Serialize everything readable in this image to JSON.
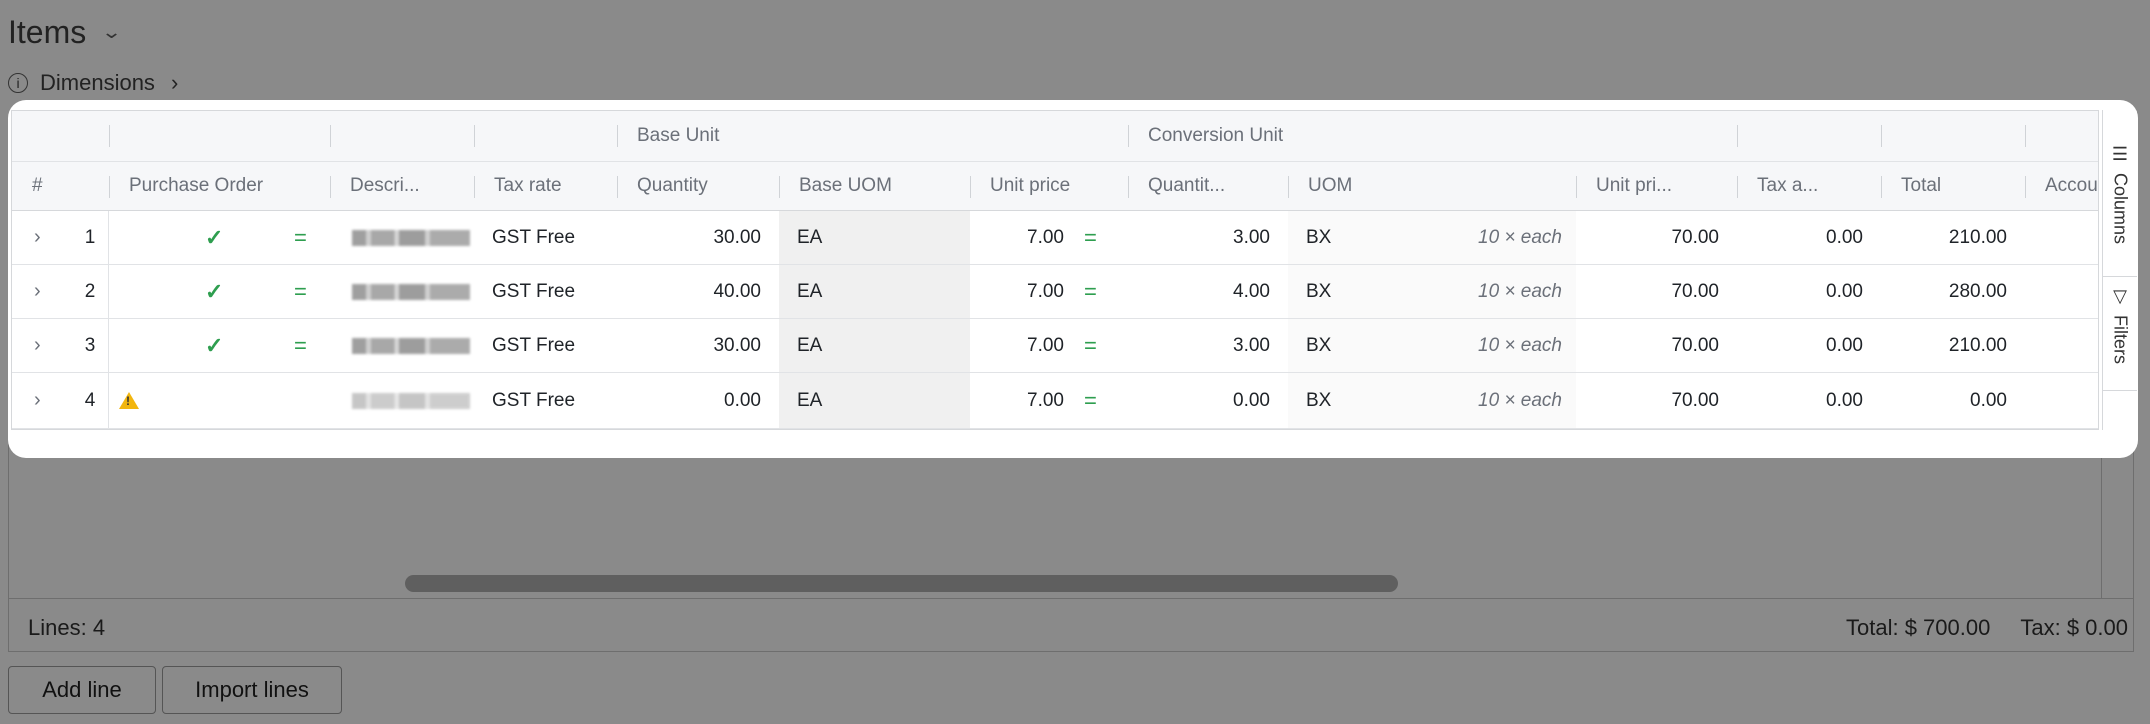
{
  "page": {
    "title": "Items",
    "dimensions_label": "Dimensions"
  },
  "grid": {
    "group_headers": {
      "base_unit": "Base Unit",
      "conversion_unit": "Conversion Unit"
    },
    "columns": {
      "num": "#",
      "purchase_order": "Purchase Order",
      "description": "Descri...",
      "tax_rate": "Tax rate",
      "quantity": "Quantity",
      "base_uom": "Base UOM",
      "unit_price": "Unit price",
      "conv_quantity": "Quantit...",
      "uom": "UOM",
      "conv_unit_price": "Unit pri...",
      "tax_amount": "Tax a...",
      "total": "Total",
      "account": "Accou"
    },
    "rows": [
      {
        "n": "1",
        "tax_rate": "GST Free",
        "quantity": "30.00",
        "base_uom": "EA",
        "unit_price": "7.00",
        "conv_quantity": "3.00",
        "uom": "BX",
        "uom_note": "10 × each",
        "conv_unit_price": "70.00",
        "tax_amount": "0.00",
        "total": "210.00",
        "status": "ok"
      },
      {
        "n": "2",
        "tax_rate": "GST Free",
        "quantity": "40.00",
        "base_uom": "EA",
        "unit_price": "7.00",
        "conv_quantity": "4.00",
        "uom": "BX",
        "uom_note": "10 × each",
        "conv_unit_price": "70.00",
        "tax_amount": "0.00",
        "total": "280.00",
        "status": "ok"
      },
      {
        "n": "3",
        "tax_rate": "GST Free",
        "quantity": "30.00",
        "base_uom": "EA",
        "unit_price": "7.00",
        "conv_quantity": "3.00",
        "uom": "BX",
        "uom_note": "10 × each",
        "conv_unit_price": "70.00",
        "tax_amount": "0.00",
        "total": "210.00",
        "status": "ok"
      },
      {
        "n": "4",
        "tax_rate": "GST Free",
        "quantity": "0.00",
        "base_uom": "EA",
        "unit_price": "7.00",
        "conv_quantity": "0.00",
        "uom": "BX",
        "uom_note": "10 × each",
        "conv_unit_price": "70.00",
        "tax_amount": "0.00",
        "total": "0.00",
        "status": "warning"
      }
    ],
    "side_tabs": {
      "columns": "Columns",
      "filters": "Filters"
    }
  },
  "footer": {
    "lines": "Lines: 4",
    "total": "Total: $ 700.00",
    "tax": "Tax: $ 0.00"
  },
  "actions": {
    "add_line": "Add line",
    "import_lines": "Import lines"
  },
  "colors": {
    "accent_green": "#2e9e4f",
    "warning": "#f2b60f",
    "overlay": "#8a8a8a"
  }
}
